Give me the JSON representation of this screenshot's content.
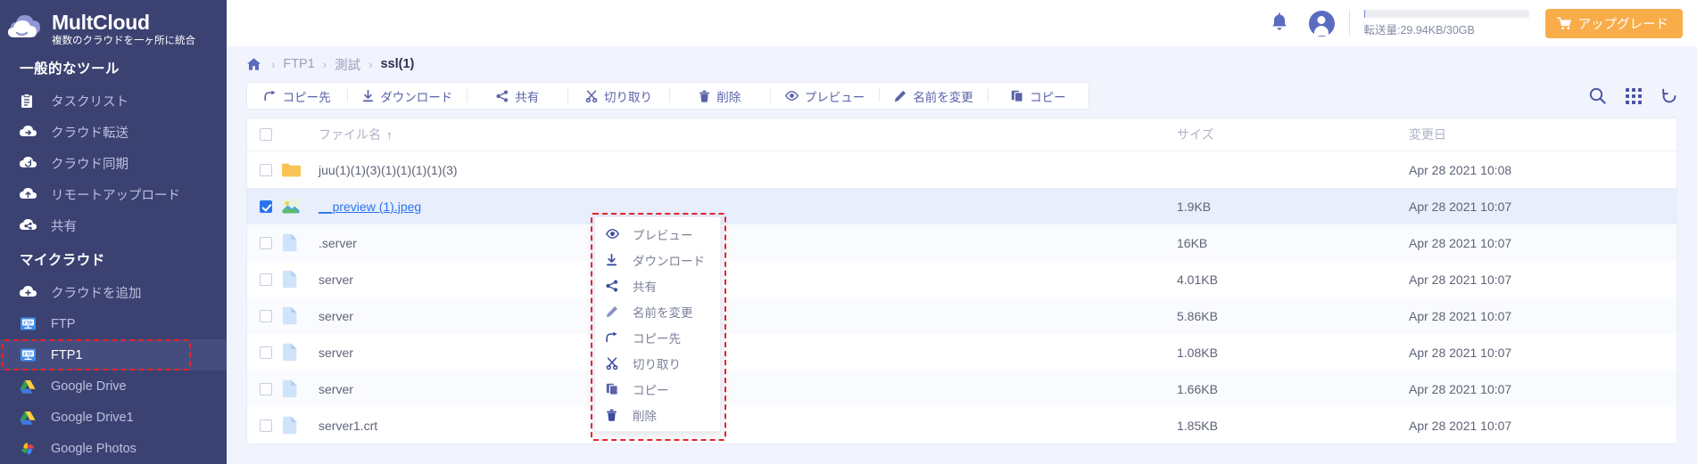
{
  "brand": {
    "name": "MultCloud",
    "tagline": "複数のクラウドを一ヶ所に統合",
    "logo_icon": "cloud-logo-icon"
  },
  "sidebar": {
    "sections": [
      {
        "title": "一般的なツール",
        "items": [
          {
            "label": "タスクリスト",
            "icon": "clipboard-icon",
            "active": false
          },
          {
            "label": "クラウド転送",
            "icon": "cloud-transfer-icon",
            "active": false
          },
          {
            "label": "クラウド同期",
            "icon": "cloud-sync-icon",
            "active": false
          },
          {
            "label": "リモートアップロード",
            "icon": "cloud-upload-icon",
            "active": false
          },
          {
            "label": "共有",
            "icon": "cloud-share-icon",
            "active": false
          }
        ]
      },
      {
        "title": "マイクラウド",
        "items": [
          {
            "label": "クラウドを追加",
            "icon": "cloud-add-icon",
            "active": false
          },
          {
            "label": "FTP",
            "icon": "ftp-icon",
            "active": false
          },
          {
            "label": "FTP1",
            "icon": "ftp-icon",
            "active": true,
            "highlighted": true
          },
          {
            "label": "Google Drive",
            "icon": "google-drive-icon",
            "active": false
          },
          {
            "label": "Google Drive1",
            "icon": "google-drive-icon",
            "active": false
          },
          {
            "label": "Google Photos",
            "icon": "google-photos-icon",
            "active": false
          }
        ]
      }
    ]
  },
  "topbar": {
    "bell_icon": "bell-icon",
    "avatar_icon": "user-avatar-icon",
    "quota_text": "転送量:29.94KB/30GB",
    "quota_percent": 1,
    "upgrade_label": "アップグレード",
    "upgrade_icon": "cart-icon",
    "upgrade_color": "#f8ad4a"
  },
  "breadcrumb": {
    "home_icon": "home-icon",
    "separator": "›",
    "items": [
      {
        "label": "FTP1",
        "current": false
      },
      {
        "label": "測試",
        "current": false
      },
      {
        "label": "ssl(1)",
        "current": true
      }
    ]
  },
  "toolbar": {
    "buttons": [
      {
        "label": "コピー先",
        "icon": "copy-to-icon"
      },
      {
        "label": "ダウンロード",
        "icon": "download-icon"
      },
      {
        "label": "共有",
        "icon": "share-icon"
      },
      {
        "label": "切り取り",
        "icon": "cut-icon"
      },
      {
        "label": "削除",
        "icon": "trash-icon"
      },
      {
        "label": "プレビュー",
        "icon": "eye-icon"
      },
      {
        "label": "名前を変更",
        "icon": "pencil-icon"
      },
      {
        "label": "コピー",
        "icon": "copy-icon"
      }
    ],
    "right_icons": [
      {
        "name": "search-icon"
      },
      {
        "name": "grid-view-icon"
      },
      {
        "name": "refresh-icon"
      }
    ]
  },
  "table": {
    "columns": {
      "name": "ファイル名",
      "sort_arrow": "↑",
      "size": "サイズ",
      "modified": "変更日"
    },
    "rows": [
      {
        "name": "juu(1)(1)(3)(1)(1)(1)(1)(3)",
        "icon": "folder-icon",
        "size": "",
        "modified": "Apr 28 2021 10:08",
        "checked": false,
        "selected": false,
        "link": false
      },
      {
        "name": "__preview (1).jpeg",
        "icon": "image-file-icon",
        "size": "1.9KB",
        "modified": "Apr 28 2021 10:07",
        "checked": true,
        "selected": true,
        "link": true
      },
      {
        "name": ".server",
        "icon": "file-icon",
        "size": "16KB",
        "modified": "Apr 28 2021 10:07",
        "checked": false,
        "selected": false,
        "link": false
      },
      {
        "name": "server",
        "icon": "file-icon",
        "size": "4.01KB",
        "modified": "Apr 28 2021 10:07",
        "checked": false,
        "selected": false,
        "link": false
      },
      {
        "name": "server",
        "icon": "file-icon",
        "size": "5.86KB",
        "modified": "Apr 28 2021 10:07",
        "checked": false,
        "selected": false,
        "link": false
      },
      {
        "name": "server",
        "icon": "file-icon",
        "size": "1.08KB",
        "modified": "Apr 28 2021 10:07",
        "checked": false,
        "selected": false,
        "link": false
      },
      {
        "name": "server",
        "icon": "file-icon",
        "size": "1.66KB",
        "modified": "Apr 28 2021 10:07",
        "checked": false,
        "selected": false,
        "link": false
      },
      {
        "name": "server1.crt",
        "icon": "file-icon",
        "size": "1.85KB",
        "modified": "Apr 28 2021 10:07",
        "checked": false,
        "selected": false,
        "link": false
      }
    ]
  },
  "context_menu": {
    "highlighted": true,
    "items": [
      {
        "label": "プレビュー",
        "icon": "eye-icon"
      },
      {
        "label": "ダウンロード",
        "icon": "download-icon"
      },
      {
        "label": "共有",
        "icon": "share-icon"
      },
      {
        "label": "名前を変更",
        "icon": "pencil-icon"
      },
      {
        "label": "コピー先",
        "icon": "copy-to-icon"
      },
      {
        "label": "切り取り",
        "icon": "cut-icon"
      },
      {
        "label": "コピー",
        "icon": "copy-icon"
      },
      {
        "label": "削除",
        "icon": "trash-icon"
      }
    ]
  },
  "colors": {
    "sidebar_bg": "#3b4271",
    "accent_blue": "#2a74f0",
    "toolbar_text": "#5a63a8",
    "highlight_red": "#e8232a",
    "upgrade_orange": "#f8ad4a"
  }
}
